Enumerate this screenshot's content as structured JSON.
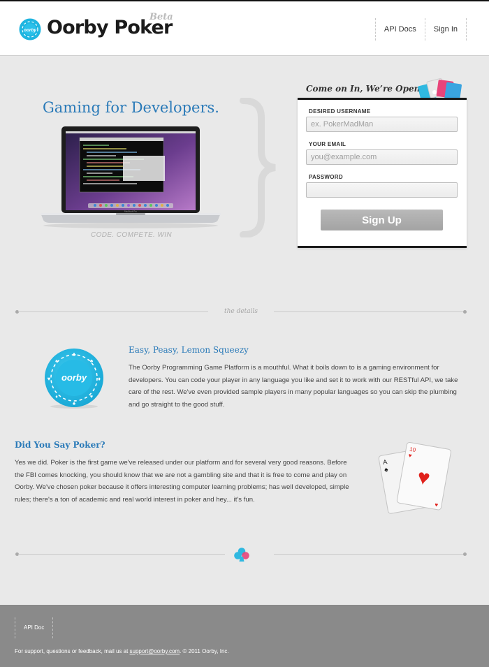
{
  "header": {
    "logo_icon": "poker-chip-logo-icon",
    "brand": "Oorby Poker",
    "beta": "Beta",
    "nav": [
      {
        "label": "API Docs"
      },
      {
        "label": "Sign In"
      }
    ]
  },
  "hero": {
    "title": "Gaming for Developers.",
    "tagline": "CODE. COMPETE. WIN",
    "laptop_caption": "MacBook Pro"
  },
  "signup": {
    "heading": "Come on In, We’re Open",
    "username_label": "DESIRED USERNAME",
    "username_placeholder": "ex. PokerMadMan",
    "email_label": "YOUR EMAIL",
    "email_placeholder": "you@example.com",
    "password_label": "PASSWORD",
    "button": "Sign Up"
  },
  "details": {
    "divider_label": "the details",
    "chip_text": "oorby",
    "section1": {
      "title": "Easy, Peasy, Lemon Squeezy",
      "body": "The Oorby Programming Game Platform is a mouthful. What it boils down to is a gaming environment for developers. You can code your player in any language you like and set it to work with our RESTful API, we take care of the rest. We've even provided sample players in many popular languages so you can skip the plumbing and go straight to the good stuff."
    },
    "section2": {
      "title": "Did You Say Poker?",
      "body": "Yes we did. Poker is the first game we've released under our platform and for several very good reasons. Before the FBI comes knocking, you should know that we are not a gambling site and that it is free to come and play on Oorby. We've chosen poker because it offers interesting computer learning problems; has well developed, simple rules; there's a ton of academic and real world interest in poker and hey... it's fun.",
      "card1_rank": "A",
      "card2_rank": "10"
    }
  },
  "footer": {
    "nav": [
      {
        "label": "API Doc"
      }
    ],
    "support_prefix": "For support, questions or feedback, mail us at ",
    "email": "support@oorby.com",
    "copyright": ". © 2011 Oorby, Inc."
  },
  "colors": {
    "accent": "#2a7ab8",
    "chip": "#1fb5e0",
    "footer_bg": "#8a8a8a",
    "page_bg": "#e9e9e9"
  }
}
